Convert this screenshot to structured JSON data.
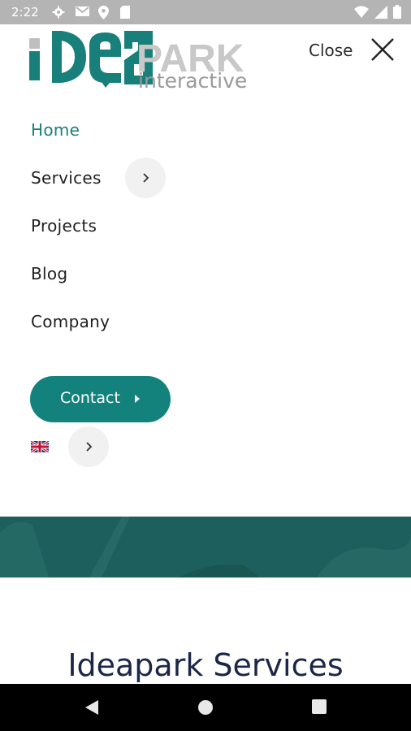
{
  "status_bar": {
    "time": "2:22",
    "left_icons": [
      "settings-icon",
      "gmail-icon",
      "location-icon",
      "sd-card-icon"
    ],
    "right_icons": [
      "wifi-icon",
      "cell-signal-icon",
      "battery-icon"
    ]
  },
  "header": {
    "logo_text_main": "PARK",
    "logo_text_sub": "interactive",
    "close_label": "Close",
    "brand_color": "#197f7a"
  },
  "menu": {
    "items": [
      {
        "label": "Home",
        "active": true
      },
      {
        "label": "Services",
        "has_submenu": true
      },
      {
        "label": "Projects"
      },
      {
        "label": "Blog"
      },
      {
        "label": "Company"
      }
    ],
    "contact_label": "Contact",
    "language_flag": "uk-flag-icon"
  },
  "page": {
    "section_title": "Ideapark Services"
  },
  "nav_bar": {
    "buttons": [
      "back-icon",
      "home-icon",
      "recents-icon"
    ]
  }
}
